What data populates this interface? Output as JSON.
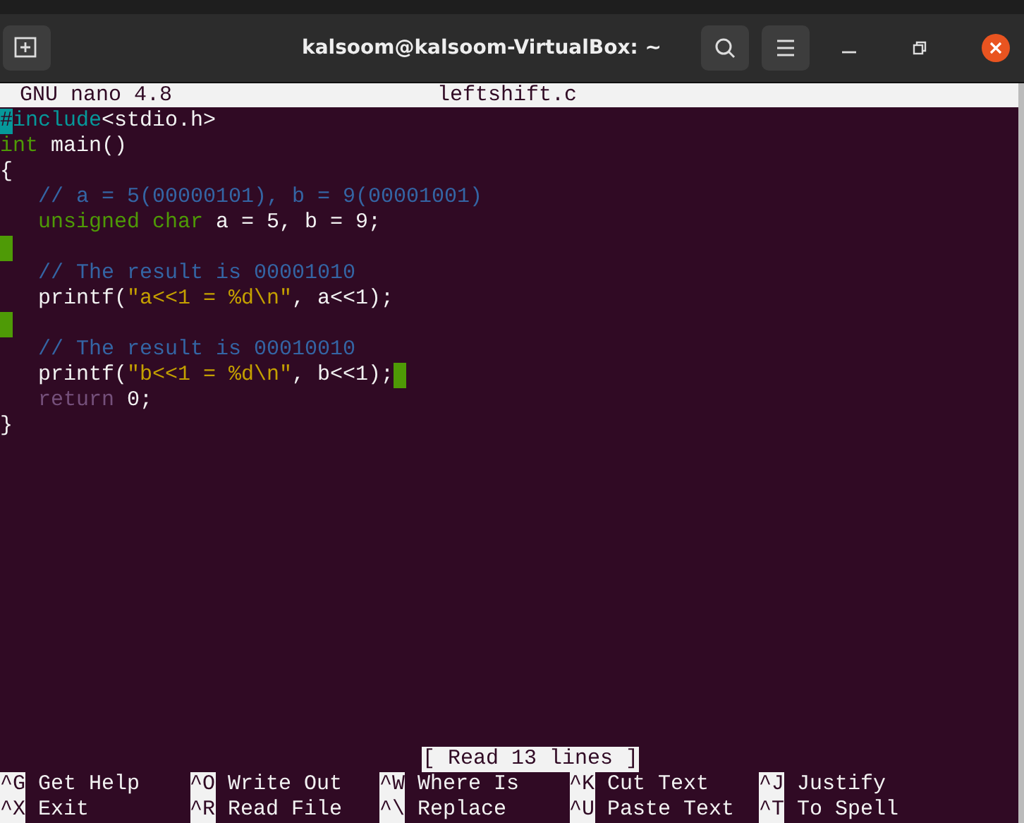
{
  "window": {
    "title": "kalsoom@kalsoom-VirtualBox: ~"
  },
  "nano_header": {
    "version": "GNU nano 4.8",
    "filename": "leftshift.c"
  },
  "lines": [
    {
      "tokens": [
        {
          "kind": "preproc",
          "text": "#include"
        },
        {
          "kind": "plain",
          "text": "<stdio.h>"
        }
      ],
      "cursor": true,
      "trailing_space": false
    },
    {
      "tokens": [
        {
          "kind": "type",
          "text": "int"
        },
        {
          "kind": "plain",
          "text": " main()"
        }
      ],
      "cursor": false,
      "trailing_space": false
    },
    {
      "tokens": [
        {
          "kind": "plain",
          "text": "{"
        }
      ],
      "cursor": false,
      "trailing_space": false
    },
    {
      "tokens": [
        {
          "kind": "comment",
          "text": "   // a = 5(00000101), b = 9(00001001)"
        }
      ],
      "cursor": false,
      "trailing_space": false
    },
    {
      "tokens": [
        {
          "kind": "type",
          "text": "   unsigned char"
        },
        {
          "kind": "plain",
          "text": " a = 5, b = 9;"
        }
      ],
      "cursor": false,
      "trailing_space": false
    },
    {
      "cursor": false,
      "trailing_space": true
    },
    {
      "tokens": [
        {
          "kind": "comment",
          "text": "   // The result is 00001010"
        }
      ],
      "cursor": false,
      "trailing_space": false
    },
    {
      "tokens": [
        {
          "kind": "plain",
          "text": "   printf("
        },
        {
          "kind": "string",
          "text": "\"a<<1 = %d\\n\""
        },
        {
          "kind": "plain",
          "text": ", a<<1);"
        }
      ],
      "cursor": false,
      "trailing_space": false
    },
    {
      "cursor": false,
      "trailing_space": true
    },
    {
      "tokens": [
        {
          "kind": "comment",
          "text": "   // The result is 00010010"
        }
      ],
      "cursor": false,
      "trailing_space": false
    },
    {
      "tokens": [
        {
          "kind": "plain",
          "text": "   printf("
        },
        {
          "kind": "string",
          "text": "\"b<<1 = %d\\n\""
        },
        {
          "kind": "plain",
          "text": ", b<<1);"
        }
      ],
      "cursor": false,
      "trailing_space": true
    },
    {
      "tokens": [
        {
          "kind": "keyword",
          "text": "   return"
        },
        {
          "kind": "plain",
          "text": " 0;"
        }
      ],
      "cursor": false,
      "trailing_space": false
    },
    {
      "tokens": [
        {
          "kind": "plain",
          "text": "}"
        }
      ],
      "cursor": false,
      "trailing_space": false
    }
  ],
  "status": "[ Read 13 lines ]",
  "shortcuts": [
    [
      {
        "key": "^G",
        "label": "Get Help"
      },
      {
        "key": "^O",
        "label": "Write Out"
      },
      {
        "key": "^W",
        "label": "Where Is"
      },
      {
        "key": "^K",
        "label": "Cut Text"
      },
      {
        "key": "^J",
        "label": "Justify"
      }
    ],
    [
      {
        "key": "^X",
        "label": "Exit"
      },
      {
        "key": "^R",
        "label": "Read File"
      },
      {
        "key": "^\\",
        "label": "Replace"
      },
      {
        "key": "^U",
        "label": "Paste Text"
      },
      {
        "key": "^T",
        "label": "To Spell"
      }
    ]
  ]
}
